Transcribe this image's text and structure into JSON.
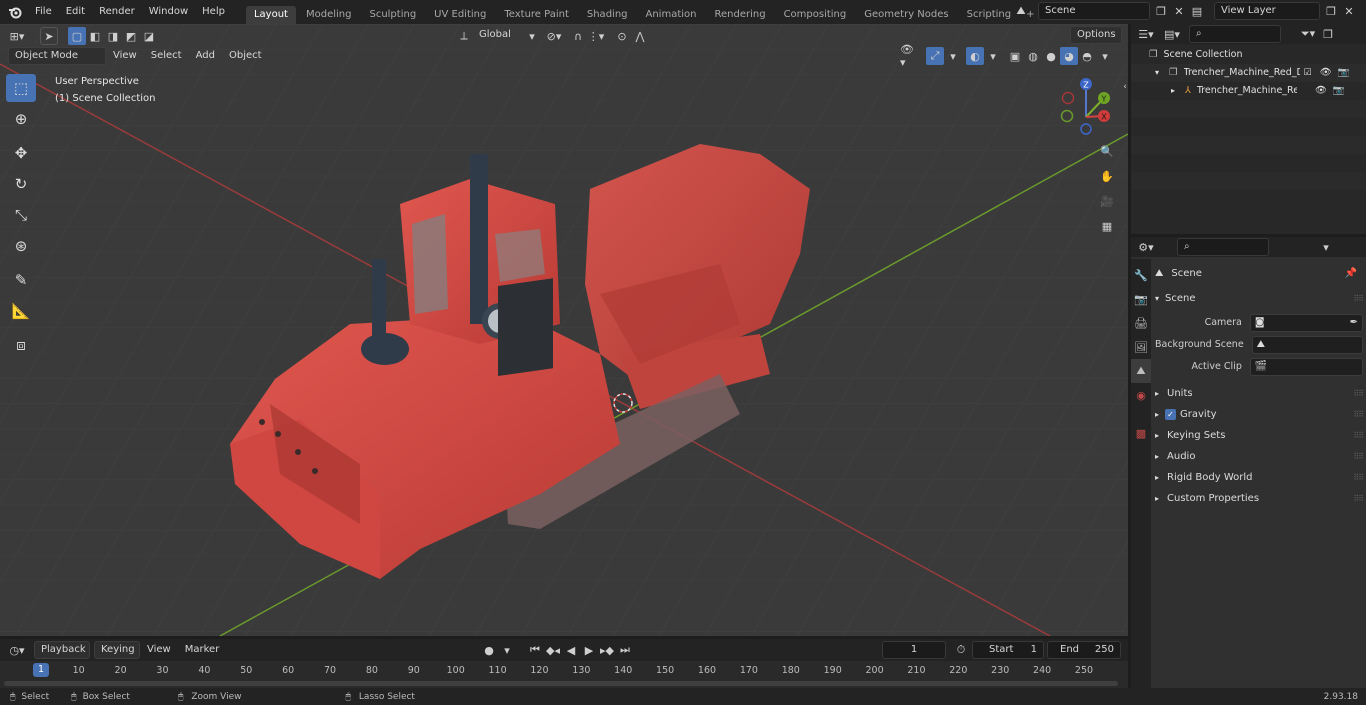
{
  "topbar": {
    "menus": [
      "File",
      "Edit",
      "Render",
      "Window",
      "Help"
    ],
    "workspaces": [
      "Layout",
      "Modeling",
      "Sculpting",
      "UV Editing",
      "Texture Paint",
      "Shading",
      "Animation",
      "Rendering",
      "Compositing",
      "Geometry Nodes",
      "Scripting"
    ],
    "active_workspace": "Layout",
    "scene_name": "Scene",
    "view_layer": "View Layer"
  },
  "viewport": {
    "transform_orientation": "Global",
    "options_label": "Options",
    "mode": "Object Mode",
    "header_menus": [
      "View",
      "Select",
      "Add",
      "Object"
    ],
    "overlay_line1": "User Perspective",
    "overlay_line2": "(1) Scene Collection",
    "gizmo_labels": {
      "z": "Z",
      "y": "Y",
      "x": "X"
    }
  },
  "outliner": {
    "root": "Scene Collection",
    "items": [
      {
        "name": "Trencher_Machine_Red_Dusty",
        "depth": 1
      },
      {
        "name": "Trencher_Machine_Red_D",
        "depth": 2
      }
    ]
  },
  "properties": {
    "context": "Scene",
    "panel_title": "Scene",
    "fields": [
      {
        "label": "Camera",
        "value": ""
      },
      {
        "label": "Background Scene",
        "value": ""
      },
      {
        "label": "Active Clip",
        "value": ""
      }
    ],
    "subpanels": [
      "Units",
      "Gravity",
      "Keying Sets",
      "Audio",
      "Rigid Body World",
      "Custom Properties"
    ],
    "gravity_checked": true
  },
  "timeline": {
    "menus": [
      "Playback",
      "Keying",
      "View",
      "Marker"
    ],
    "current_frame": "1",
    "start_label": "Start",
    "start": "1",
    "end_label": "End",
    "end": "250",
    "ticks": [
      "1",
      "10",
      "20",
      "30",
      "40",
      "50",
      "60",
      "70",
      "80",
      "90",
      "100",
      "110",
      "120",
      "130",
      "140",
      "150",
      "160",
      "170",
      "180",
      "190",
      "200",
      "210",
      "220",
      "230",
      "240",
      "250"
    ]
  },
  "statusbar": {
    "items": [
      "Select",
      "Box Select",
      "Zoom View",
      "Lasso Select"
    ],
    "version": "2.93.18"
  },
  "colors": {
    "accent": "#4772b3",
    "model_red": "#d24a44",
    "axis_x": "#9a3b3b",
    "axis_y": "#6a9a2c"
  }
}
